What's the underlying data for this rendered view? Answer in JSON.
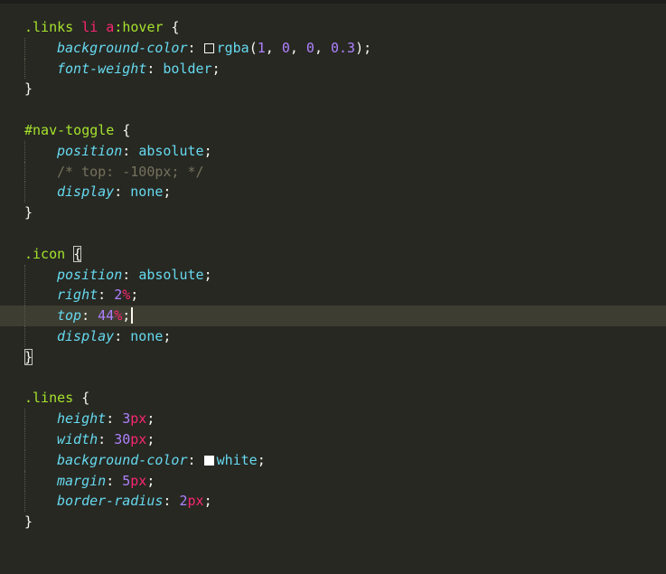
{
  "theme": {
    "background": "#272822",
    "current_line": "#3e3d32",
    "selector": "#a6e22e",
    "property": "#66d9ef",
    "number": "#ae81ff",
    "unit": "#f92672",
    "comment": "#75715e",
    "text": "#f8f8f2"
  },
  "editor": {
    "rules": [
      {
        "selector_class": ".links",
        "selector_tags": " li a",
        "selector_pseudo": ":hover",
        "brace_open": " {",
        "decl_bg_prop": "background-color",
        "decl_bg_value": "rgba",
        "decl_bg_args": [
          "1",
          "0",
          "0",
          "0.3"
        ],
        "decl_fw_prop": "font-weight",
        "decl_fw_value": "bolder",
        "brace_close": "}"
      },
      {
        "selector": "#nav-toggle",
        "brace_open": " {",
        "decl_pos_prop": "position",
        "decl_pos_value": "absolute",
        "comment": "/* top: -100px; */",
        "decl_disp_prop": "display",
        "decl_disp_value": "none",
        "brace_close": "}"
      },
      {
        "selector": ".icon",
        "brace_open": "{",
        "decl_pos_prop": "position",
        "decl_pos_value": "absolute",
        "decl_right_prop": "right",
        "decl_right_num": "2",
        "decl_right_unit": "%",
        "decl_top_prop": "top",
        "decl_top_num": "44",
        "decl_top_unit": "%",
        "decl_disp_prop": "display",
        "decl_disp_value": "none",
        "brace_close": "}"
      },
      {
        "selector": ".lines",
        "brace_open": " {",
        "decl_h_prop": "height",
        "decl_h_num": "3",
        "decl_h_unit": "px",
        "decl_w_prop": "width",
        "decl_w_num": "30",
        "decl_w_unit": "px",
        "decl_bg_prop": "background-color",
        "decl_bg_value": "white",
        "decl_m_prop": "margin",
        "decl_m_num": "5",
        "decl_m_unit": "px",
        "decl_br_prop": "border-radius",
        "decl_br_num": "2",
        "decl_br_unit": "px",
        "brace_close": "}"
      }
    ]
  },
  "punctuation": {
    "colon": ": ",
    "semicolon": ";",
    "paren_open": "(",
    "paren_close": ")",
    "comma": ", ",
    "space": " "
  }
}
